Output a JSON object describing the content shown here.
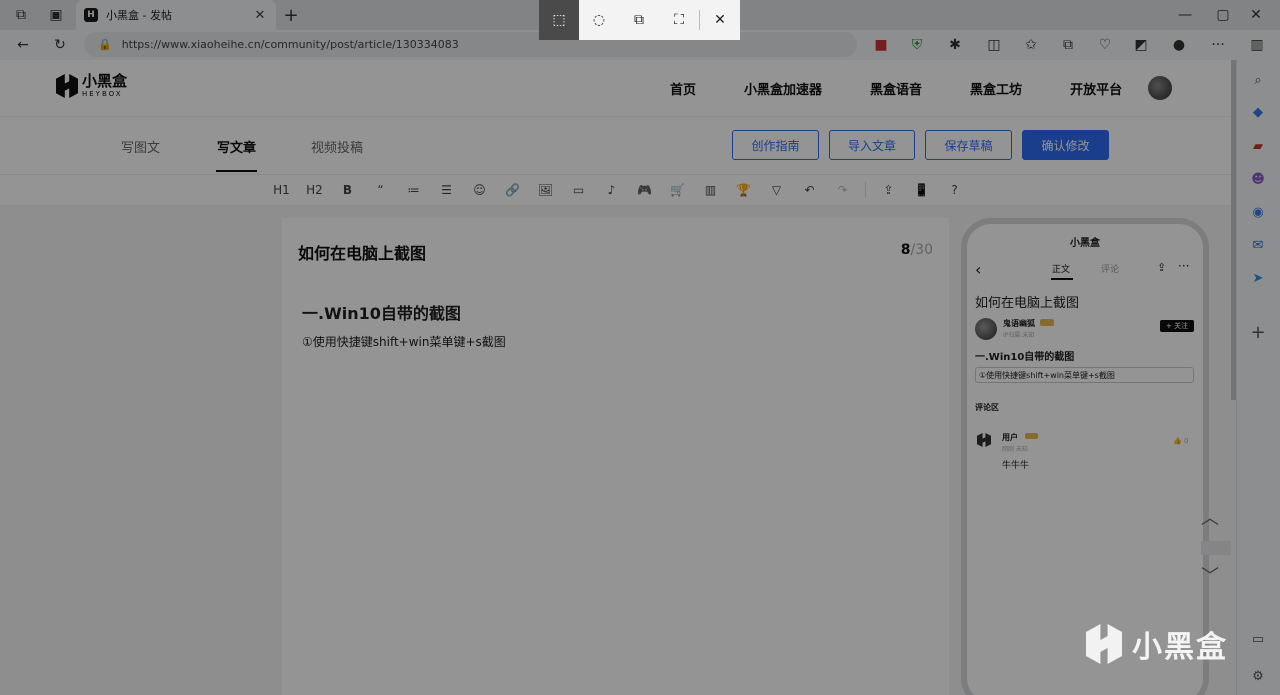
{
  "browser": {
    "tab_title": "小黑盒 - 发帖",
    "tab_favicon": "H",
    "url": "https://www.xiaoheihe.cn/community/post/article/130334083"
  },
  "site": {
    "logo_cn": "小黑盒",
    "logo_en": "HEYBOX",
    "nav": [
      "首页",
      "小黑盒加速器",
      "黑盒语音",
      "黑盒工坊",
      "开放平台"
    ]
  },
  "editor_tabs": [
    "写图文",
    "写文章",
    "视频投稿"
  ],
  "actions": {
    "guide": "创作指南",
    "import": "导入文章",
    "save_draft": "保存草稿",
    "confirm": "确认修改"
  },
  "toolbar": [
    "H1",
    "H2",
    "B",
    "“",
    "≔",
    "☰",
    "☺",
    "🔗",
    "🖼",
    "▭",
    "♪",
    "🎮",
    "🛒",
    "▥",
    "🏆",
    "▽",
    "↶",
    "↷",
    "⇪",
    "📱",
    "?"
  ],
  "post": {
    "title": "如何在电脑上截图",
    "title_count": "8",
    "title_max": "/30",
    "heading": "一.Win10自带的截图",
    "paragraph": "①使用快捷键shift+win菜单键+s截图"
  },
  "preview": {
    "logo": "小黑盒",
    "tab_main": "正文",
    "tab_comments": "评论",
    "title": "如何在电脑上截图",
    "author": "鬼语幽狐",
    "author_sub": "IP归属:未知",
    "follow": "+ 关注",
    "heading": "一.Win10自带的截图",
    "paragraph": "①使用快捷键shift+win菜单键+s截图",
    "comments_header": "评论区",
    "comment_user": "用户",
    "comment_user_sub": "刚刚 未知",
    "comment_likes": "0",
    "comment_text": "牛牛牛"
  },
  "watermark": "小黑盒",
  "accent_color": "#2f6cf2"
}
